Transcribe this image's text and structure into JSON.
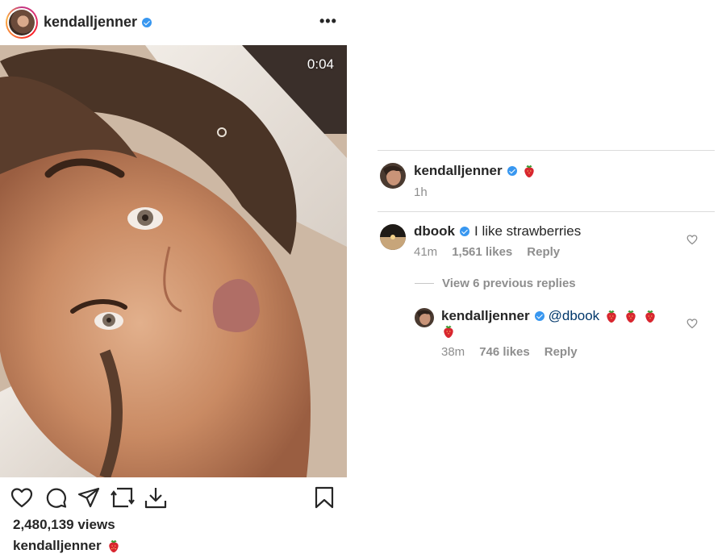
{
  "post": {
    "username": "kendalljenner",
    "more_label": "•••",
    "video_timer": "0:04",
    "views": "2,480,139 views",
    "caption_user": "kendalljenner"
  },
  "comments_panel": {
    "post_comment": {
      "username": "kendalljenner",
      "time": "1h"
    },
    "comment": {
      "username": "dbook",
      "text": "I like strawberries",
      "time": "41m",
      "likes": "1,561 likes",
      "reply_label": "Reply"
    },
    "view_replies": "View 6 previous replies",
    "reply": {
      "username": "kendalljenner",
      "mention": "@dbook",
      "time": "38m",
      "likes": "746 likes",
      "reply_label": "Reply"
    }
  },
  "icons": {
    "like": "heart-icon",
    "comment": "comment-icon",
    "share": "share-icon",
    "repost": "repost-icon",
    "download": "download-icon",
    "save": "bookmark-icon",
    "verified": "verified-badge-icon",
    "emoji": "strawberry-emoji"
  },
  "colors": {
    "verified": "#3897f0",
    "secondary_text": "#8e8e8e",
    "mention": "#00376b",
    "divider": "#dbdbdb"
  }
}
